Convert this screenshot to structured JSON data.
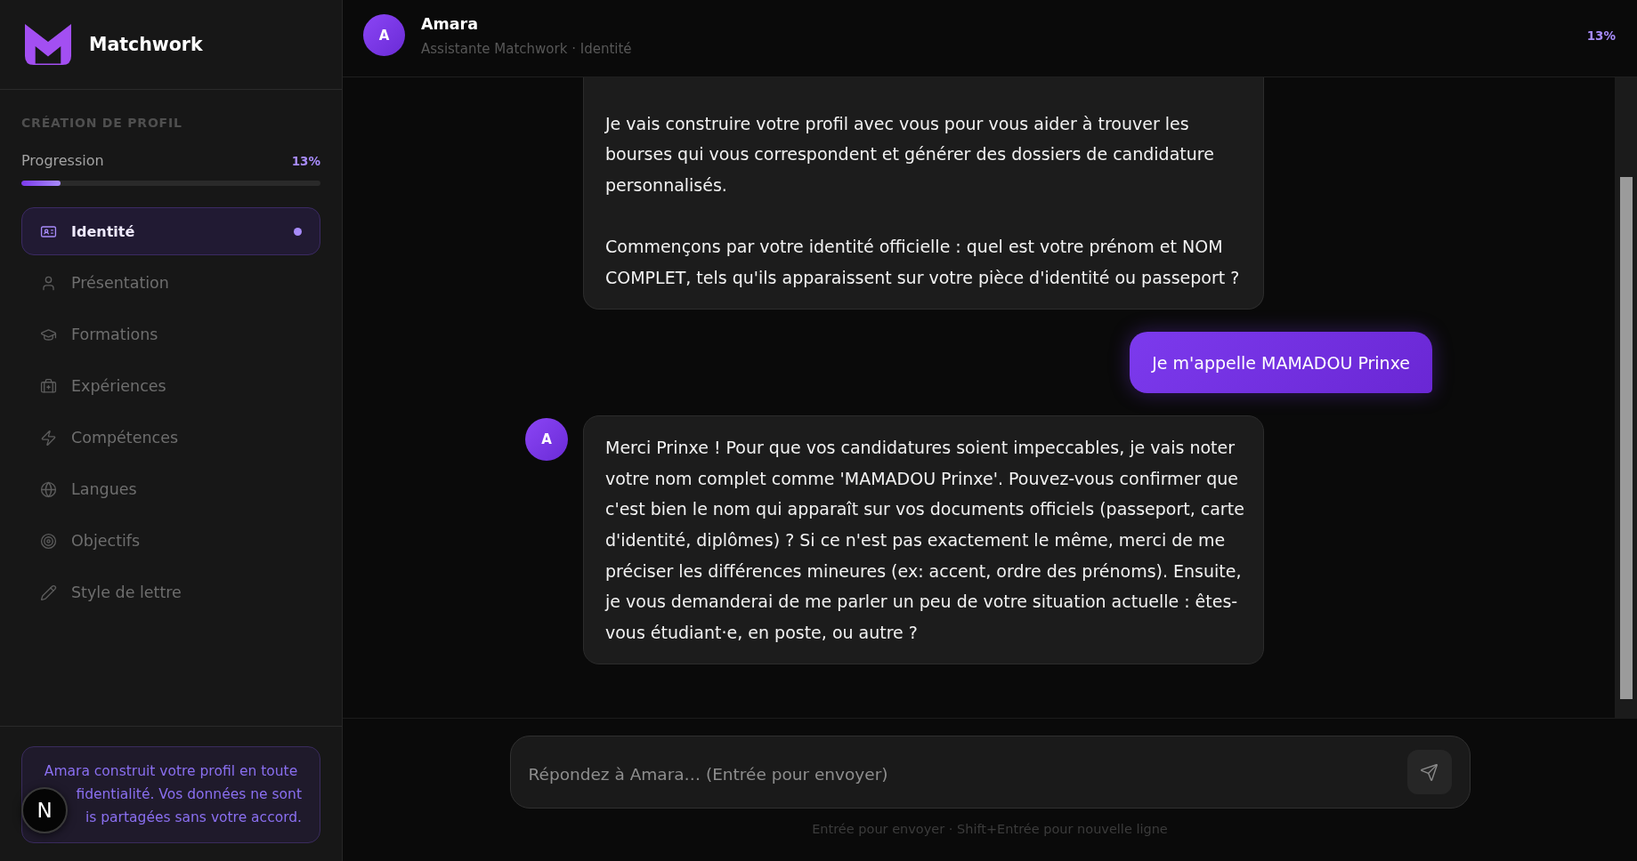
{
  "sidebar": {
    "brand": "Matchwork",
    "section_title": "CRÉATION DE PROFIL",
    "progress": {
      "label": "Progression",
      "value": "13%",
      "level": 0.13
    },
    "steps": [
      {
        "label": "Identité",
        "selected": true
      },
      {
        "label": "Présentation",
        "selected": false
      },
      {
        "label": "Formations",
        "selected": false
      },
      {
        "label": "Expériences",
        "selected": false
      },
      {
        "label": "Compétences",
        "selected": false
      },
      {
        "label": "Langues",
        "selected": false
      },
      {
        "label": "Objectifs",
        "selected": false
      },
      {
        "label": "Style de lettre",
        "selected": false
      }
    ],
    "privacy_note": [
      "Amara construit votre profil en toute",
      "fidentialité. Vos données ne sont",
      "is partagées sans votre accord."
    ]
  },
  "overlay_badge": "N",
  "chat": {
    "header": {
      "avatar": "A",
      "name": "Amara",
      "subtitle": "Assistante Matchwork · Identité",
      "progress": "13%"
    },
    "messages": [
      {
        "kind": "assistant",
        "cut_top": true,
        "paragraphs": [
          [
            "Je vais construire votre profil avec vous pour vous aider à trouver les",
            "bourses qui vous correspondent et générer des dossiers de candidature",
            "personnalisés."
          ],
          [
            "Commençons par votre identité officielle : quel est votre prénom et NOM",
            "COMPLET, tels qu'ils apparaissent sur votre pièce d'identité ou passeport ?"
          ]
        ]
      },
      {
        "kind": "user",
        "text": "Je m'appelle MAMADOU Prinxe"
      },
      {
        "kind": "assistant",
        "avatar": "A",
        "cut_top": false,
        "paragraphs": [
          [
            "Merci Prinxe ! Pour que vos candidatures soient impeccables, je vais noter",
            "votre nom complet comme 'MAMADOU Prinxe'. Pouvez-vous confirmer que",
            "c'est bien le nom qui apparaît sur vos documents officiels (passeport, carte",
            "d'identité, diplômes) ? Si ce n'est pas exactement le même, merci de me",
            "préciser les différences mineures (ex: accent, ordre des prénoms). Ensuite,",
            "je vous demanderai de me parler un peu de votre situation actuelle : êtes-",
            "vous étudiant·e, en poste, ou autre ?"
          ]
        ]
      }
    ],
    "composer": {
      "placeholder": "Répondez à Amara… (Entrée pour envoyer)",
      "hint": "Entrée pour envoyer · Shift+Entrée pour nouvelle ligne"
    }
  }
}
